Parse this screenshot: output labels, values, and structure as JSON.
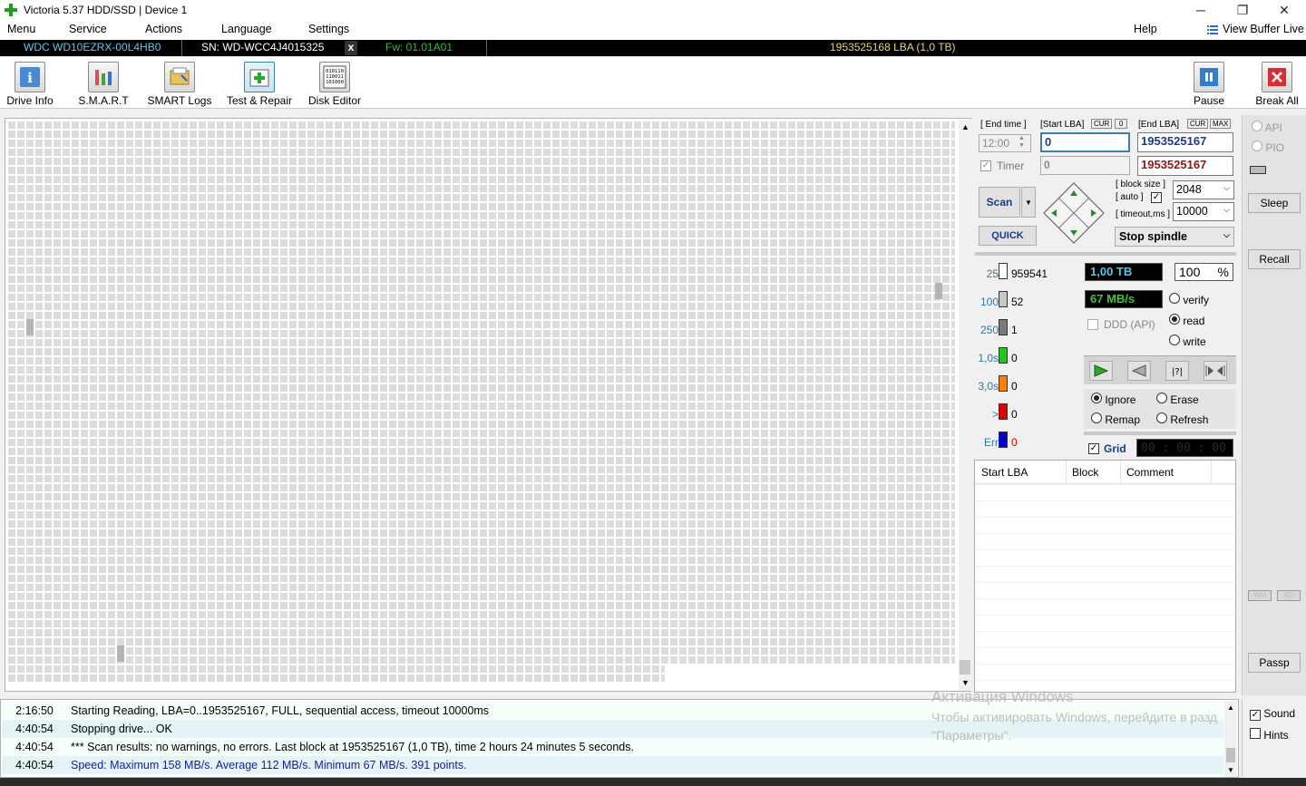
{
  "window": {
    "title": "Victoria 5.37 HDD/SSD | Device 1",
    "controls": [
      "─",
      "❐",
      "✕"
    ]
  },
  "menu": {
    "items": [
      "Menu",
      "Service",
      "Actions",
      "Language",
      "Settings"
    ],
    "help": "Help",
    "buffer": "View Buffer Live"
  },
  "drive": {
    "model": "WDC WD10EZRX-00L4HB0",
    "serial": "SN: WD-WCC4J4015325",
    "close": "x",
    "firmware": "Fw: 01.01A01",
    "lba": "1953525168 LBA (1,0 TB)"
  },
  "toolbar": {
    "buttons": [
      {
        "label": "Drive Info",
        "icon": "info-icon"
      },
      {
        "label": "S.M.A.R.T",
        "icon": "smart-icon"
      },
      {
        "label": "SMART Logs",
        "icon": "logs-icon"
      },
      {
        "label": "Test & Repair",
        "icon": "test-repair-icon"
      },
      {
        "label": "Disk Editor",
        "icon": "disk-editor-icon"
      }
    ],
    "pause": "Pause",
    "break_all": "Break All"
  },
  "scan": {
    "end_time_label": "[ End time ]",
    "start_lba_label": "[Start LBA]",
    "cur": "CUR",
    "zero": "0",
    "end_lba_label": "[End LBA]",
    "max": "MAX",
    "end_time_value": "12:00",
    "start_lba_value": "0",
    "end_lba_value": "1953525167",
    "timer_label": "Timer",
    "timer_value": "0",
    "end_lba_value2": "1953525167",
    "scan_button": "Scan",
    "quick_button": "QUICK",
    "block_size_label": "[ block size ]",
    "auto_label": "[ auto ]",
    "timeout_label": "[ timeout,ms ]",
    "block_size": "2048",
    "timeout": "10000",
    "stop_spindle": "Stop spindle"
  },
  "stats": {
    "rows": [
      {
        "label": "25",
        "value": "959541",
        "color": "#ffffff"
      },
      {
        "label": "100",
        "value": "52",
        "color": "#c8c8c8"
      },
      {
        "label": "250",
        "value": "1",
        "color": "#7a7a7a"
      },
      {
        "label": "1,0s",
        "value": "0",
        "color": "#22c422"
      },
      {
        "label": "3,0s",
        "value": "0",
        "color": "#ff7f00"
      },
      {
        "label": ">",
        "value": "0",
        "color": "#e00000"
      },
      {
        "label": "Err",
        "value": "0",
        "color": "#0000d0"
      }
    ],
    "capacity": "1,00 TB",
    "percent": "100",
    "percent_sign": "%",
    "speed": "67 MB/s",
    "ddd": "DDD (API)",
    "modes": [
      "verify",
      "read",
      "write"
    ],
    "selected_mode": "read",
    "actions": [
      "Ignore",
      "Erase",
      "Remap",
      "Refresh"
    ],
    "selected_action": "Ignore",
    "grid_label": "Grid",
    "clock": "00 : 00 : 00"
  },
  "table": {
    "headers": [
      "Start LBA",
      "Block",
      "Comment"
    ]
  },
  "side": {
    "api": "API",
    "pio": "PIO",
    "sleep": "Sleep",
    "recall": "Recall",
    "wr": "WR",
    "rd": "RD",
    "passp": "Passp",
    "sound": "Sound",
    "hints": "Hints"
  },
  "log": [
    {
      "time": "2:16:50",
      "text": "Starting Reading, LBA=0..1953525167, FULL, sequential access, timeout 10000ms",
      "color": "#000000"
    },
    {
      "time": "4:40:54",
      "text": "Stopping drive... OK",
      "color": "#000000"
    },
    {
      "time": "4:40:54",
      "text": "*** Scan results: no warnings, no errors. Last block at 1953525167 (1,0 TB), time 2 hours 24 minutes 5 seconds.",
      "color": "#000000"
    },
    {
      "time": "4:40:54",
      "text": "Speed: Maximum 158 MB/s. Average 112 MB/s. Minimum 67 MB/s. 391 points.",
      "color": "#1a1aa6"
    }
  ],
  "watermark": {
    "line1": "Активация Windows",
    "line2": "Чтобы активировать Windows, перейдите в разд",
    "line3": "\"Параметры\"."
  }
}
